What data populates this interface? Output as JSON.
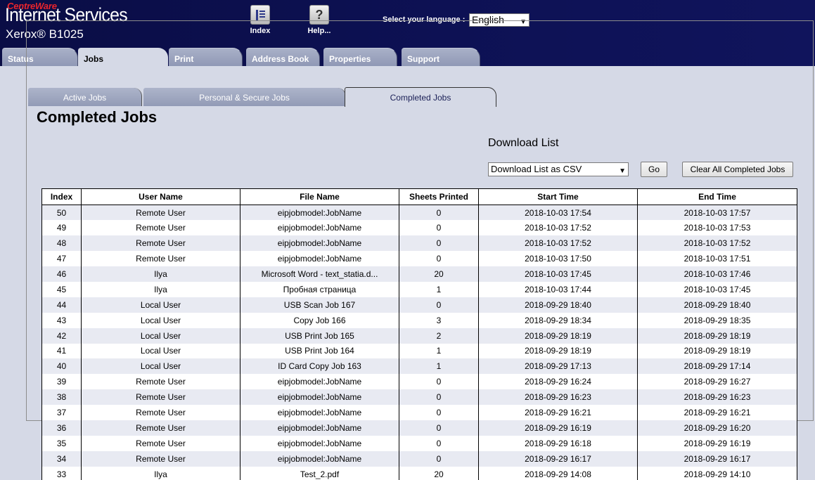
{
  "header": {
    "brand_top": "CentreWare",
    "brand_main": "Internet Services",
    "model": "Xerox® B1025",
    "links": [
      {
        "label": "Index",
        "icon": "index-icon"
      },
      {
        "label": "Help...",
        "icon": "help-icon"
      }
    ],
    "language_label": "Select your language :",
    "language_value": "English"
  },
  "main_tabs": [
    "Status",
    "Jobs",
    "Print",
    "Address Book",
    "Properties",
    "Support"
  ],
  "active_main_tab": "Jobs",
  "sub_tabs": [
    "Active Jobs",
    "Personal & Secure Jobs",
    "Completed Jobs"
  ],
  "active_sub_tab": "Completed Jobs",
  "page_title": "Completed Jobs",
  "download": {
    "label": "Download List",
    "select_value": "Download List as CSV",
    "go_label": "Go",
    "clear_label": "Clear All Completed Jobs"
  },
  "table": {
    "columns": [
      "Index",
      "User Name",
      "File Name",
      "Sheets Printed",
      "Start Time",
      "End Time"
    ],
    "rows": [
      [
        "50",
        "Remote User",
        "eipjobmodel:JobName",
        "0",
        "2018-10-03 17:54",
        "2018-10-03 17:57"
      ],
      [
        "49",
        "Remote User",
        "eipjobmodel:JobName",
        "0",
        "2018-10-03 17:52",
        "2018-10-03 17:53"
      ],
      [
        "48",
        "Remote User",
        "eipjobmodel:JobName",
        "0",
        "2018-10-03 17:52",
        "2018-10-03 17:52"
      ],
      [
        "47",
        "Remote User",
        "eipjobmodel:JobName",
        "0",
        "2018-10-03 17:50",
        "2018-10-03 17:51"
      ],
      [
        "46",
        "Ilya",
        "Microsoft Word - text_statia.d...",
        "20",
        "2018-10-03 17:45",
        "2018-10-03 17:46"
      ],
      [
        "45",
        "Ilya",
        "Пробная страница",
        "1",
        "2018-10-03 17:44",
        "2018-10-03 17:45"
      ],
      [
        "44",
        "Local User",
        "USB Scan Job 167",
        "0",
        "2018-09-29 18:40",
        "2018-09-29 18:40"
      ],
      [
        "43",
        "Local User",
        "Copy Job 166",
        "3",
        "2018-09-29 18:34",
        "2018-09-29 18:35"
      ],
      [
        "42",
        "Local User",
        "USB Print Job 165",
        "2",
        "2018-09-29 18:19",
        "2018-09-29 18:19"
      ],
      [
        "41",
        "Local User",
        "USB Print Job 164",
        "1",
        "2018-09-29 18:19",
        "2018-09-29 18:19"
      ],
      [
        "40",
        "Local User",
        "ID Card Copy Job 163",
        "1",
        "2018-09-29 17:13",
        "2018-09-29 17:14"
      ],
      [
        "39",
        "Remote User",
        "eipjobmodel:JobName",
        "0",
        "2018-09-29 16:24",
        "2018-09-29 16:27"
      ],
      [
        "38",
        "Remote User",
        "eipjobmodel:JobName",
        "0",
        "2018-09-29 16:23",
        "2018-09-29 16:23"
      ],
      [
        "37",
        "Remote User",
        "eipjobmodel:JobName",
        "0",
        "2018-09-29 16:21",
        "2018-09-29 16:21"
      ],
      [
        "36",
        "Remote User",
        "eipjobmodel:JobName",
        "0",
        "2018-09-29 16:19",
        "2018-09-29 16:20"
      ],
      [
        "35",
        "Remote User",
        "eipjobmodel:JobName",
        "0",
        "2018-09-29 16:18",
        "2018-09-29 16:19"
      ],
      [
        "34",
        "Remote User",
        "eipjobmodel:JobName",
        "0",
        "2018-09-29 16:17",
        "2018-09-29 16:17"
      ],
      [
        "33",
        "Ilya",
        "Test_2.pdf",
        "20",
        "2018-09-29 14:08",
        "2018-09-29 14:10"
      ]
    ]
  }
}
